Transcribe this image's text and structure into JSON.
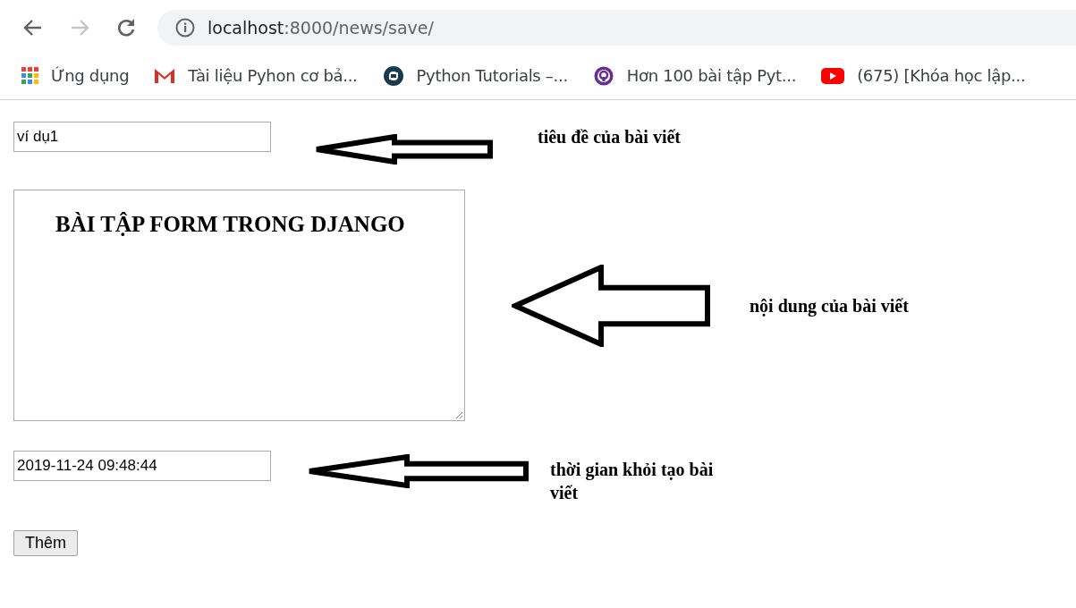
{
  "browser": {
    "url_host": "localhost",
    "url_path": ":8000/news/save/",
    "forward_disabled": true
  },
  "bookmarks": [
    {
      "kind": "apps",
      "label": "Ứng dụng"
    },
    {
      "kind": "mail",
      "label": "Tài liệu Pyhon cơ bả..."
    },
    {
      "kind": "globe",
      "label": "Python Tutorials –..."
    },
    {
      "kind": "ring",
      "label": "Hơn 100 bài tập Pyt..."
    },
    {
      "kind": "video",
      "label": "(675) [Khóa học lập..."
    }
  ],
  "form": {
    "rows": [
      {
        "kind": "input",
        "value": "ví dụ1",
        "note": "tiêu đề của bài viết"
      },
      {
        "kind": "textarea",
        "value": "BÀI TẬP FORM TRONG DJANGO",
        "note": "nội dung của bài viết"
      },
      {
        "kind": "input",
        "value": "2019-11-24 09:48:44",
        "note": "thời gian khỏi tạo bài viết"
      }
    ],
    "submit": "Thêm"
  }
}
